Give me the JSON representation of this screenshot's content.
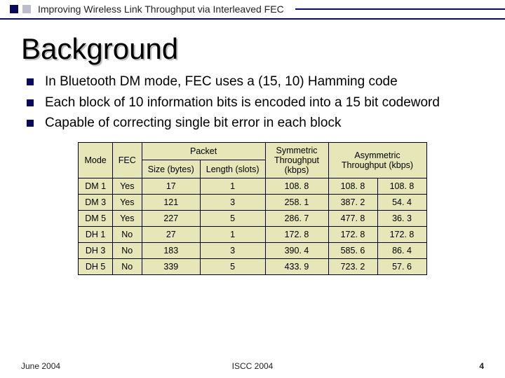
{
  "header": {
    "running_title": "Improving Wireless Link Throughput via Interleaved FEC"
  },
  "title": "Background",
  "bullets": [
    "In Bluetooth DM mode, FEC uses a (15, 10) Hamming code",
    "Each block of 10 information bits is encoded into a 15 bit codeword",
    "Capable of correcting single bit error in each block"
  ],
  "table": {
    "head": {
      "mode": "Mode",
      "fec": "FEC",
      "packet": "Packet",
      "size": "Size (bytes)",
      "length": "Length (slots)",
      "sym": "Symmetric Throughput (kbps)",
      "asym": "Asymmetric Throughput (kbps)"
    },
    "rows": [
      {
        "mode": "DM 1",
        "fec": "Yes",
        "size": "17",
        "length": "1",
        "sym": "108. 8",
        "asym_a": "108. 8",
        "asym_b": "108. 8"
      },
      {
        "mode": "DM 3",
        "fec": "Yes",
        "size": "121",
        "length": "3",
        "sym": "258. 1",
        "asym_a": "387. 2",
        "asym_b": "54. 4"
      },
      {
        "mode": "DM 5",
        "fec": "Yes",
        "size": "227",
        "length": "5",
        "sym": "286. 7",
        "asym_a": "477. 8",
        "asym_b": "36. 3"
      },
      {
        "mode": "DH 1",
        "fec": "No",
        "size": "27",
        "length": "1",
        "sym": "172. 8",
        "asym_a": "172. 8",
        "asym_b": "172. 8"
      },
      {
        "mode": "DH 3",
        "fec": "No",
        "size": "183",
        "length": "3",
        "sym": "390. 4",
        "asym_a": "585. 6",
        "asym_b": "86. 4"
      },
      {
        "mode": "DH 5",
        "fec": "No",
        "size": "339",
        "length": "5",
        "sym": "433. 9",
        "asym_a": "723. 2",
        "asym_b": "57. 6"
      }
    ]
  },
  "footer": {
    "left": "June 2004",
    "center": "ISCC 2004",
    "right": "4"
  },
  "chart_data": {
    "type": "table",
    "title": "Bluetooth packet modes throughput",
    "columns": [
      "Mode",
      "FEC",
      "Size (bytes)",
      "Length (slots)",
      "Symmetric Throughput (kbps)",
      "Asymmetric Throughput fwd (kbps)",
      "Asymmetric Throughput rev (kbps)"
    ],
    "rows": [
      [
        "DM1",
        "Yes",
        17,
        1,
        108.8,
        108.8,
        108.8
      ],
      [
        "DM3",
        "Yes",
        121,
        3,
        258.1,
        387.2,
        54.4
      ],
      [
        "DM5",
        "Yes",
        227,
        5,
        286.7,
        477.8,
        36.3
      ],
      [
        "DH1",
        "No",
        27,
        1,
        172.8,
        172.8,
        172.8
      ],
      [
        "DH3",
        "No",
        183,
        3,
        390.4,
        585.6,
        86.4
      ],
      [
        "DH5",
        "No",
        339,
        5,
        433.9,
        723.2,
        57.6
      ]
    ]
  }
}
